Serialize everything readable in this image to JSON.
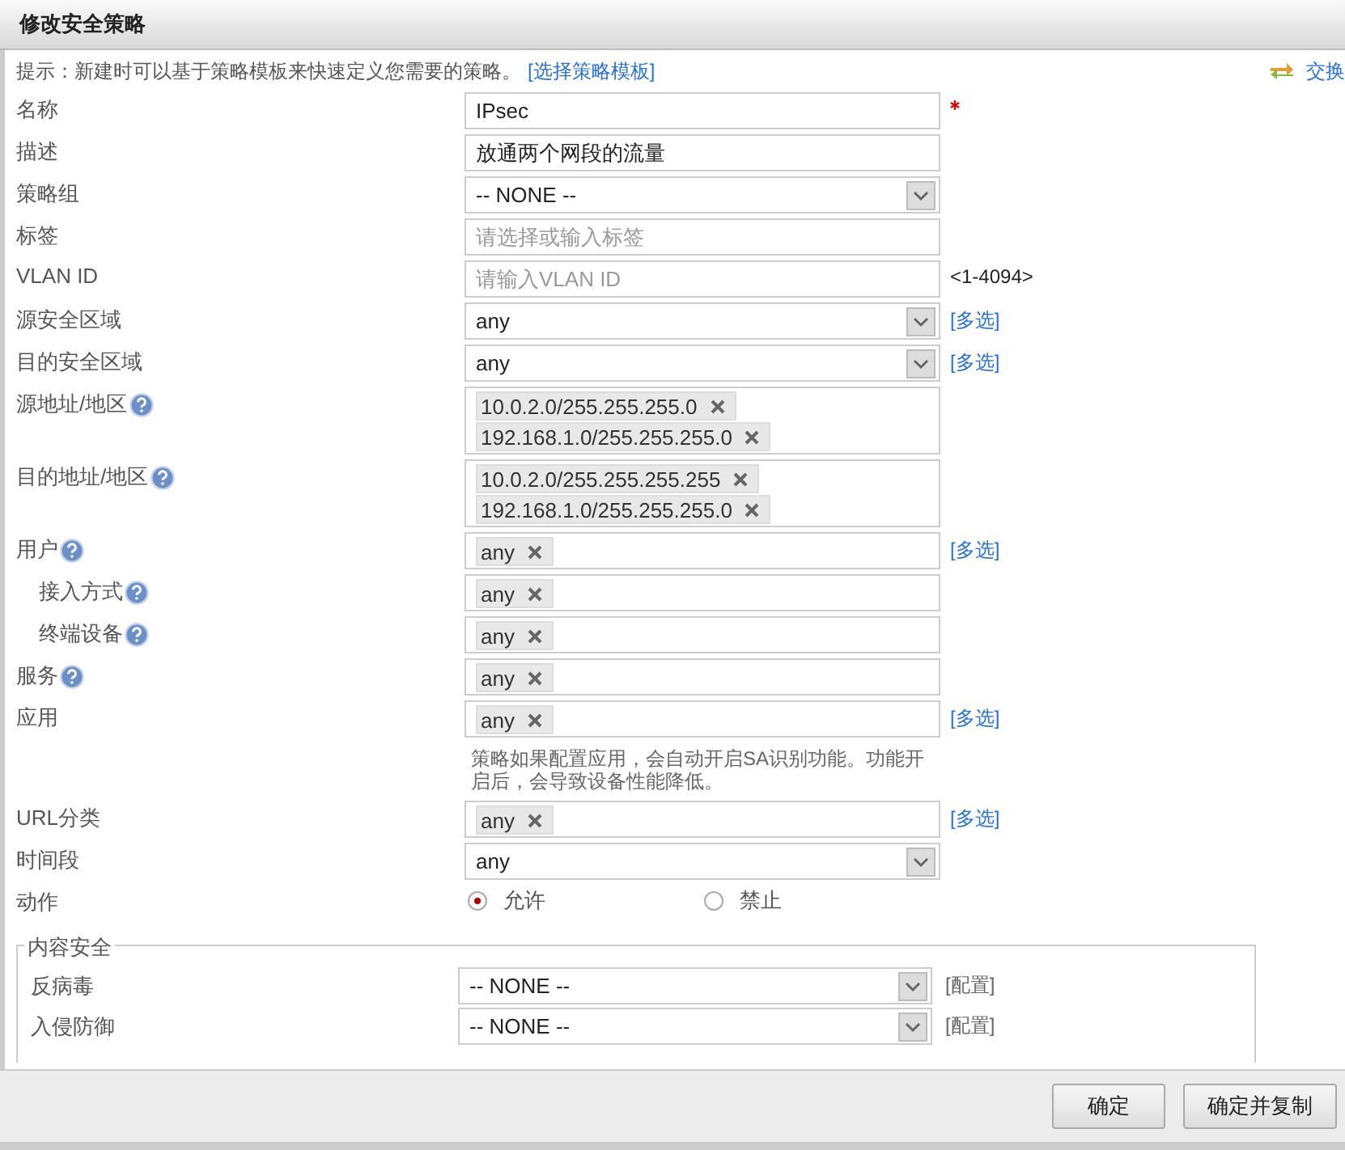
{
  "window": {
    "title": "修改安全策略"
  },
  "tip": {
    "text": "提示：新建时可以基于策略模板来快速定义您需要的策略。",
    "link": "[选择策略模板]",
    "swap": "交换"
  },
  "fields": [
    {
      "label": "名称",
      "kind": "text",
      "value": "IPsec",
      "required": true
    },
    {
      "label": "描述",
      "kind": "text",
      "value": "放通两个网段的流量"
    },
    {
      "label": "策略组",
      "kind": "select",
      "value": "-- NONE --"
    },
    {
      "label": "标签",
      "kind": "text",
      "placeholder": "请选择或输入标签"
    },
    {
      "label": "VLAN ID",
      "kind": "text",
      "placeholder": "请输入VLAN ID",
      "hint": "<1-4094>"
    },
    {
      "label": "源安全区域",
      "kind": "select",
      "value": "any",
      "link": "[多选]"
    },
    {
      "label": "目的安全区域",
      "kind": "select",
      "value": "any",
      "link": "[多选]"
    },
    {
      "label": "源地址/地区",
      "kind": "tags",
      "help": true,
      "tags": [
        "10.0.2.0/255.255.255.0",
        "192.168.1.0/255.255.255.0"
      ]
    },
    {
      "label": "目的地址/地区",
      "kind": "tags",
      "help": true,
      "tags": [
        "10.0.2.0/255.255.255.255",
        "192.168.1.0/255.255.255.0"
      ]
    },
    {
      "label": "用户",
      "kind": "tags",
      "help": true,
      "tags": [
        "any"
      ],
      "link": "[多选]"
    },
    {
      "label": "接入方式",
      "kind": "tags",
      "help": true,
      "indent": true,
      "tags": [
        "any"
      ]
    },
    {
      "label": "终端设备",
      "kind": "tags",
      "help": true,
      "indent": true,
      "tags": [
        "any"
      ]
    },
    {
      "label": "服务",
      "kind": "tags",
      "help": true,
      "tags": [
        "any"
      ]
    },
    {
      "label": "应用",
      "kind": "tags",
      "tags": [
        "any"
      ],
      "link": "[多选]",
      "note": "策略如果配置应用，会自动开启SA识别功能。功能开启后，会导致设备性能降低。"
    },
    {
      "label": "URL分类",
      "kind": "tags",
      "tags": [
        "any"
      ],
      "link": "[多选]"
    },
    {
      "label": "时间段",
      "kind": "select",
      "value": "any"
    },
    {
      "label": "动作",
      "kind": "radio",
      "options": [
        {
          "label": "允许",
          "selected": true
        },
        {
          "label": "禁止",
          "selected": false
        }
      ]
    }
  ],
  "content_security": {
    "title": "内容安全",
    "rows": [
      {
        "label": "反病毒",
        "value": "-- NONE --",
        "action": "[配置]"
      },
      {
        "label": "入侵防御",
        "value": "-- NONE --",
        "action": "[配置]"
      }
    ]
  },
  "buttons": [
    "确定",
    "确定并复制"
  ]
}
